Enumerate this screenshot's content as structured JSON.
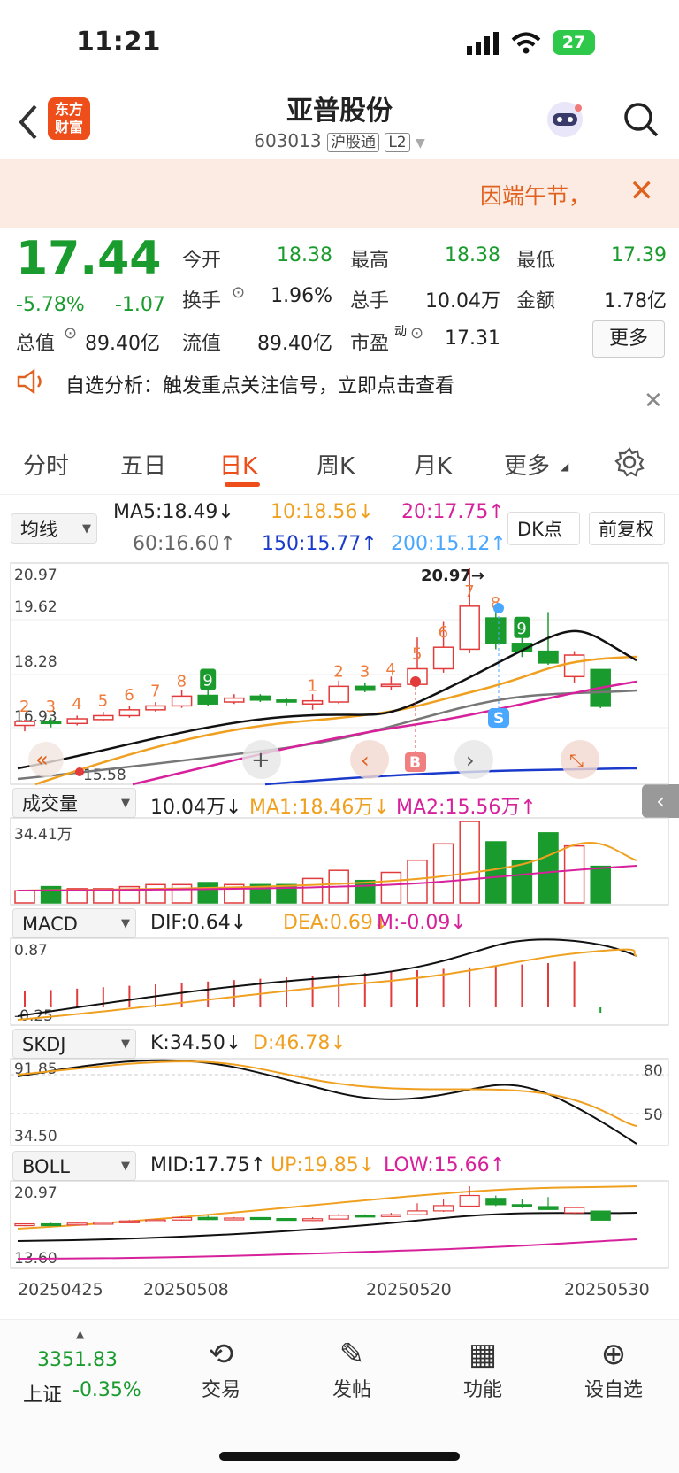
{
  "status_bar": {
    "time": "11:21",
    "battery": "27"
  },
  "header": {
    "title": "亚普股份",
    "code": "603013",
    "tag1": "沪股通",
    "tag2": "L2",
    "logo_line1": "东方",
    "logo_line2": "财富"
  },
  "notice": {
    "text": "因端午节，",
    "close": "✕"
  },
  "quote": {
    "price": "17.44",
    "pct": "-5.78%",
    "chg": "-1.07",
    "open_label": "今开",
    "open": "18.38",
    "high_label": "最高",
    "high": "18.38",
    "low_label": "最低",
    "low": "17.39",
    "turnover_label": "换手",
    "turnover": "1.96%",
    "volume_label": "总手",
    "volume": "10.04万",
    "amount_label": "金额",
    "amount": "1.78亿",
    "mcap_label": "总值",
    "mcap": "89.40亿",
    "float_label": "流值",
    "float": "89.40亿",
    "pe_label": "市盈",
    "pe_sup": "动",
    "pe": "17.31",
    "more": "更多"
  },
  "analysis": {
    "text": "自选分析：触发重点关注信号，立即点击查看",
    "close": "✕"
  },
  "tabs": [
    "分时",
    "五日",
    "日K",
    "周K",
    "月K",
    "更多"
  ],
  "kline": {
    "ma_select": "均线",
    "ma5": "MA5:18.49↓",
    "ma10": "10:18.56↓",
    "ma20": "20:17.75↑",
    "ma60": "60:16.60↑",
    "ma150": "150:15.77↑",
    "ma200": "200:15.12↑",
    "dk_btn": "DK点",
    "fq_btn": "前复权",
    "y_top": "20.97",
    "y2": "19.62",
    "y3": "18.28",
    "y4": "16.93",
    "y_low": "15.58",
    "high_marker": "20.97→",
    "b_label": "B",
    "s_label": "S"
  },
  "volume": {
    "select": "成交量",
    "v": "10.04万↓",
    "ma1": "MA1:18.46万↓",
    "ma2": "MA2:15.56万↑",
    "y_top": "34.41万"
  },
  "macd": {
    "select": "MACD",
    "dif": "DIF:0.64↓",
    "dea": "DEA:0.69↓",
    "m": "M:-0.09↓",
    "y_top": "0.87",
    "y_bot": "-0.25"
  },
  "skdj": {
    "select": "SKDJ",
    "k": "K:34.50↓",
    "d": "D:46.78↓",
    "y_top": "91.85",
    "y_bot": "34.50",
    "r80": "80",
    "r50": "50"
  },
  "boll": {
    "select": "BOLL",
    "mid": "MID:17.75↑",
    "up": "UP:19.85↓",
    "low": "LOW:15.66↑",
    "y_top": "20.97",
    "y_bot": "13.60"
  },
  "dates": [
    "20250425",
    "20250508",
    "20250520",
    "20250530"
  ],
  "bottom": {
    "index_value": "3351.83",
    "index_name": "上证",
    "index_chg": "-0.35%",
    "trade": "交易",
    "post": "发帖",
    "func": "功能",
    "watch": "设自选"
  },
  "chart_data": {
    "type": "candlestick",
    "candles": [
      {
        "o": 16.95,
        "c": 17.05,
        "h": 17.1,
        "l": 16.8,
        "n": "2"
      },
      {
        "o": 17.05,
        "c": 17.0,
        "h": 17.15,
        "l": 16.9,
        "n": "3"
      },
      {
        "o": 17.0,
        "c": 17.12,
        "h": 17.2,
        "l": 16.95,
        "n": "4"
      },
      {
        "o": 17.1,
        "c": 17.2,
        "h": 17.3,
        "l": 17.05,
        "n": "5"
      },
      {
        "o": 17.2,
        "c": 17.35,
        "h": 17.45,
        "l": 17.15,
        "n": "6"
      },
      {
        "o": 17.35,
        "c": 17.45,
        "h": 17.55,
        "l": 17.3,
        "n": "7"
      },
      {
        "o": 17.45,
        "c": 17.7,
        "h": 17.85,
        "l": 17.4,
        "n": "8"
      },
      {
        "o": 17.72,
        "c": 17.5,
        "h": 17.9,
        "l": 17.45,
        "n": "9"
      },
      {
        "o": 17.55,
        "c": 17.65,
        "h": 17.75,
        "l": 17.5,
        "n": ""
      },
      {
        "o": 17.7,
        "c": 17.6,
        "h": 17.75,
        "l": 17.55,
        "n": ""
      },
      {
        "o": 17.6,
        "c": 17.55,
        "h": 17.65,
        "l": 17.45,
        "n": ""
      },
      {
        "o": 17.5,
        "c": 17.58,
        "h": 17.75,
        "l": 17.35,
        "n": "1"
      },
      {
        "o": 17.55,
        "c": 17.95,
        "h": 18.1,
        "l": 17.5,
        "n": "2"
      },
      {
        "o": 17.95,
        "c": 17.85,
        "h": 18.05,
        "l": 17.8,
        "n": "3"
      },
      {
        "o": 17.95,
        "c": 18.0,
        "h": 18.2,
        "l": 17.85,
        "n": "4"
      },
      {
        "o": 18.0,
        "c": 18.4,
        "h": 19.2,
        "l": 17.95,
        "n": "5"
      },
      {
        "o": 18.4,
        "c": 18.95,
        "h": 19.6,
        "l": 18.3,
        "n": "6"
      },
      {
        "o": 18.9,
        "c": 20.0,
        "h": 20.97,
        "l": 18.8,
        "n": "7"
      },
      {
        "o": 19.7,
        "c": 19.05,
        "h": 20.0,
        "l": 18.9,
        "n": "8"
      },
      {
        "o": 19.05,
        "c": 18.85,
        "h": 19.6,
        "l": 18.7,
        "n": "9"
      },
      {
        "o": 18.85,
        "c": 18.55,
        "h": 19.85,
        "l": 18.5,
        "n": ""
      },
      {
        "o": 18.2,
        "c": 18.75,
        "h": 18.85,
        "l": 18.05,
        "n": ""
      },
      {
        "o": 18.38,
        "c": 17.44,
        "h": 18.38,
        "l": 17.39,
        "n": ""
      }
    ],
    "volumes": [
      6,
      8,
      7,
      7,
      8,
      9,
      9,
      10,
      9,
      9,
      9,
      12,
      16,
      11,
      15,
      21,
      29,
      40,
      30,
      21,
      34.41,
      28,
      18
    ],
    "y_range": [
      15.58,
      20.97
    ]
  }
}
